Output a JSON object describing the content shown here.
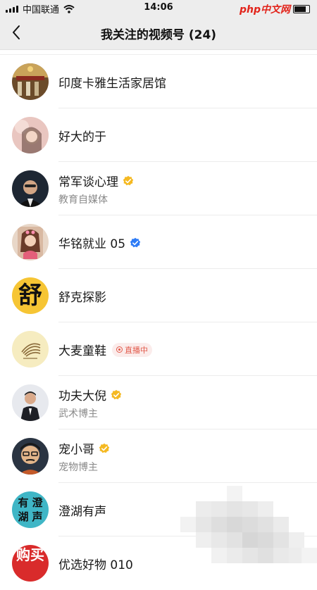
{
  "status_bar": {
    "carrier": "中国联通",
    "time": "14:06",
    "watermark": "php中文网"
  },
  "nav": {
    "title": "我关注的视频号 (24)"
  },
  "accounts": [
    {
      "name": "印度卡雅生活家居馆",
      "subtitle": "",
      "verified": "none",
      "badge": ""
    },
    {
      "name": "好大的于",
      "subtitle": "",
      "verified": "none",
      "badge": ""
    },
    {
      "name": "常军谈心理",
      "subtitle": "教育自媒体",
      "verified": "gold",
      "badge": ""
    },
    {
      "name": "华铭就业 05",
      "subtitle": "",
      "verified": "blue",
      "badge": ""
    },
    {
      "name": "舒克探影",
      "subtitle": "",
      "verified": "none",
      "badge": "",
      "avatar_glyph": "舒"
    },
    {
      "name": "大麦童鞋",
      "subtitle": "",
      "verified": "none",
      "badge": "直播中"
    },
    {
      "name": "功夫大倪",
      "subtitle": "武术博主",
      "verified": "gold",
      "badge": ""
    },
    {
      "name": "宠小哥",
      "subtitle": "宠物博主",
      "verified": "gold",
      "badge": ""
    },
    {
      "name": "澄湖有声",
      "subtitle": "",
      "verified": "none",
      "badge": "",
      "avatar_glyphs": [
        "有",
        "澄",
        "湖",
        "声"
      ]
    },
    {
      "name": "优选好物 010",
      "subtitle": "",
      "verified": "none",
      "badge": "",
      "avatar_glyph": "购买"
    }
  ],
  "colors": {
    "header_bg": "#ededed",
    "verified_gold": "#f5b922",
    "verified_blue": "#2e7cf6",
    "live_red": "#e25a4b"
  }
}
